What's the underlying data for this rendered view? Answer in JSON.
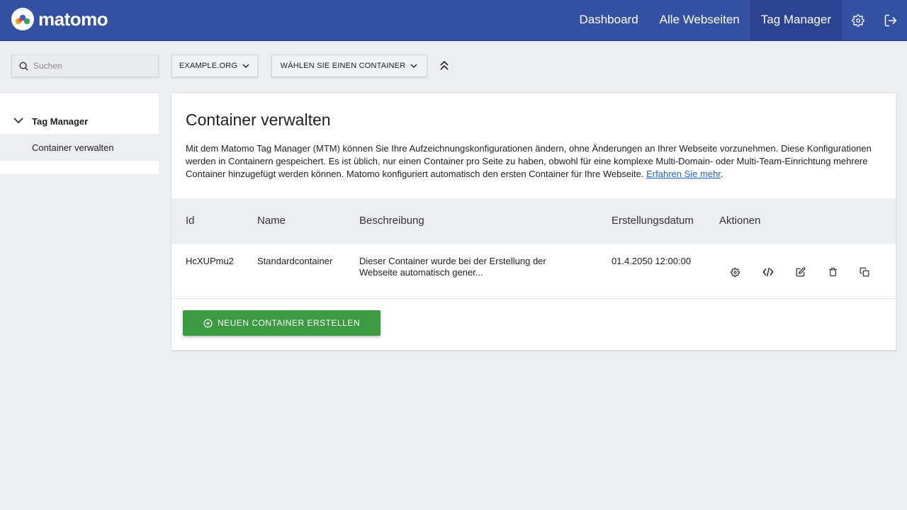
{
  "app": {
    "name": "matomo"
  },
  "nav": {
    "items": [
      {
        "label": "Dashboard"
      },
      {
        "label": "Alle Webseiten"
      },
      {
        "label": "Tag Manager",
        "active": true
      }
    ],
    "icons": [
      "gear-icon",
      "logout-icon"
    ]
  },
  "toolbar": {
    "search_placeholder": "Suchen",
    "site_selector": "EXAMPLE.ORG",
    "container_selector": "WÄHLEN SIE EINEN CONTAINER"
  },
  "sidebar": {
    "section": "Tag Manager",
    "items": [
      {
        "label": "Container verwalten",
        "active": true
      }
    ]
  },
  "main": {
    "title": "Container verwalten",
    "description": "Mit dem Matomo Tag Manager (MTM) können Sie Ihre Aufzeichnungskonfigurationen ändern, ohne Änderungen an Ihrer Webseite vorzunehmen. Diese Konfigurationen werden in Containern gespeichert. Es ist üblich, nur einen Container pro Seite zu haben, obwohl für eine komplexe Multi-Domain- oder Multi-Team-Einrichtung mehrere Container hinzugefügt werden können. Matomo konfiguriert automatisch den ersten Container für Ihre Webseite.",
    "learn_more": "Erfahren Sie mehr",
    "table": {
      "columns": [
        "Id",
        "Name",
        "Beschreibung",
        "Erstellungsdatum",
        "Aktionen"
      ],
      "rows": [
        {
          "id": "HcXUPmu2",
          "name": "Standardcontainer",
          "description": "Dieser Container wurde bei der Erstellung der Webseite automatisch gener...",
          "created": "01.4.2050 12:00:00",
          "actions": [
            "gear-icon",
            "code-icon",
            "edit-icon",
            "trash-icon",
            "copy-icon"
          ]
        }
      ]
    },
    "create_button": "NEUEN CONTAINER ERSTELLEN"
  },
  "colors": {
    "header": "#3450a3",
    "header_active": "#2b4391",
    "primary_button": "#3c9a42",
    "link": "#1a66c9",
    "background": "#eceef1"
  }
}
